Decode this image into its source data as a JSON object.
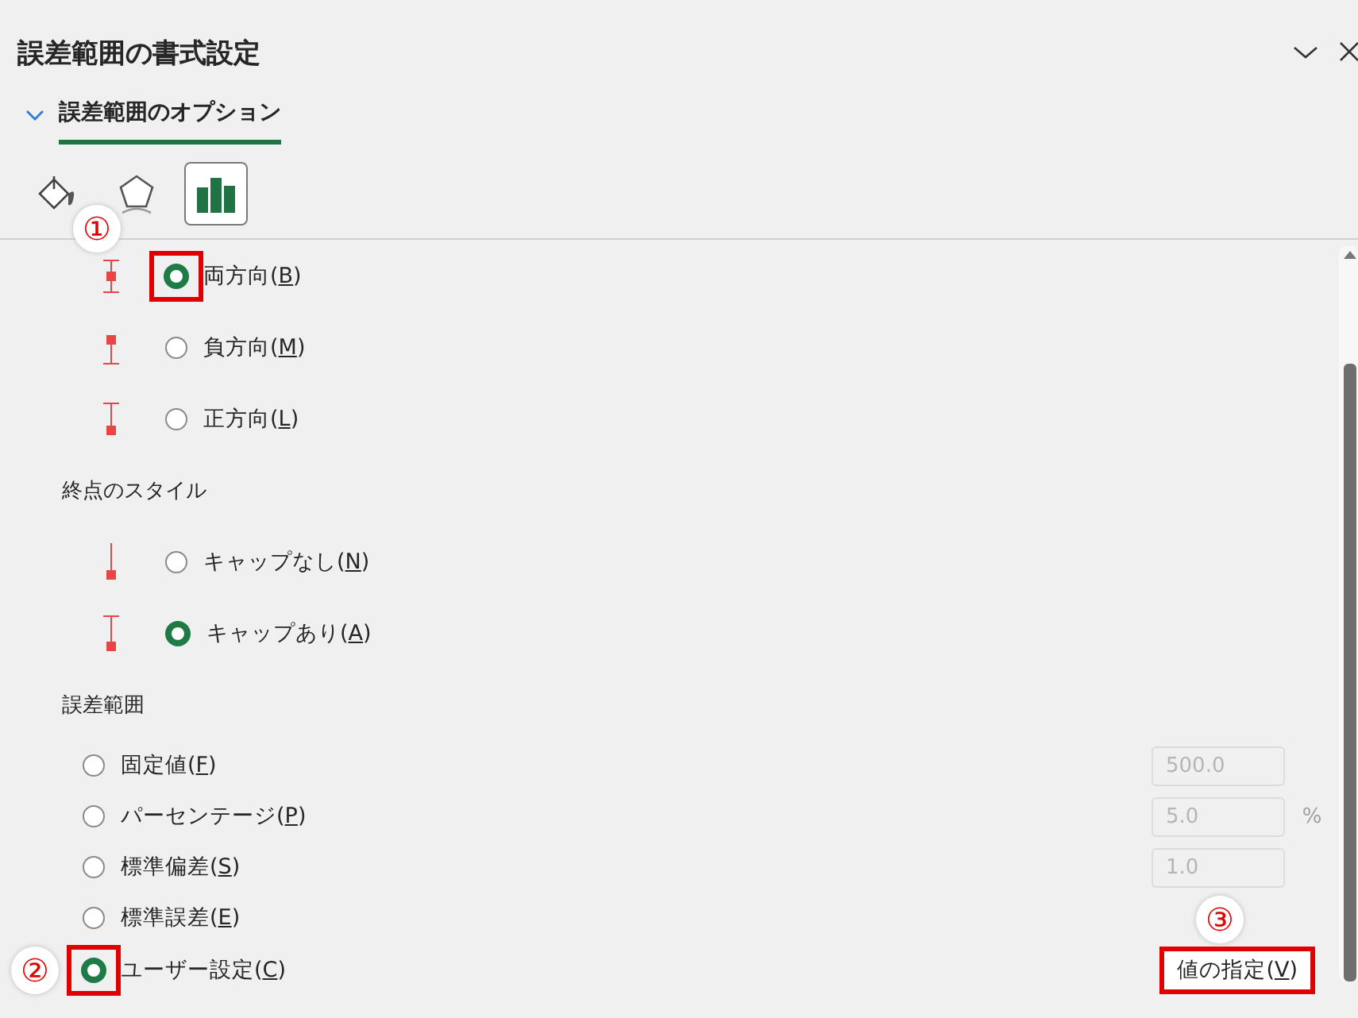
{
  "panel": {
    "title": "誤差範囲の書式設定"
  },
  "section": {
    "label": "誤差範囲のオプション",
    "expanded": true
  },
  "icon_tabs": [
    {
      "kind": "fill",
      "selected": false
    },
    {
      "kind": "shape",
      "selected": false
    },
    {
      "kind": "chart",
      "selected": true
    }
  ],
  "direction_options": [
    {
      "kind": "both",
      "label": "両方向(",
      "accel": "B",
      "after": ")",
      "selected": true,
      "highlighted": true,
      "callout": "①"
    },
    {
      "kind": "minus",
      "label": "負方向(",
      "accel": "M",
      "after": ")",
      "selected": false
    },
    {
      "kind": "plus",
      "label": "正方向(",
      "accel": "L",
      "after": ")",
      "selected": false
    }
  ],
  "end_style": {
    "heading": "終点のスタイル",
    "options": [
      {
        "kind": "nocap",
        "label": "キャップなし(",
        "accel": "N",
        "after": ")",
        "selected": false
      },
      {
        "kind": "cap",
        "label": "キャップあり(",
        "accel": "A",
        "after": ")",
        "selected": true
      }
    ]
  },
  "error_amount": {
    "heading": "誤差範囲",
    "options": [
      {
        "label": "固定値(",
        "accel": "F",
        "after": ")",
        "selected": false,
        "value": "500.0",
        "disabled": true
      },
      {
        "label": "パーセンテージ(",
        "accel": "P",
        "after": ")",
        "selected": false,
        "value": "5.0",
        "unit": "%",
        "disabled": true
      },
      {
        "label": "標準偏差(",
        "accel": "S",
        "after": ")",
        "selected": false,
        "value": "1.0",
        "disabled": true
      },
      {
        "label": "標準誤差(",
        "accel": "E",
        "after": ")",
        "selected": false
      },
      {
        "label": "ユーザー設定(",
        "accel": "C",
        "after": ")",
        "selected": true,
        "highlighted": true,
        "callout": "②",
        "button": {
          "label": "値の指定(",
          "accel": "V",
          "after": ")",
          "highlighted": true,
          "callout": "③"
        }
      }
    ]
  }
}
